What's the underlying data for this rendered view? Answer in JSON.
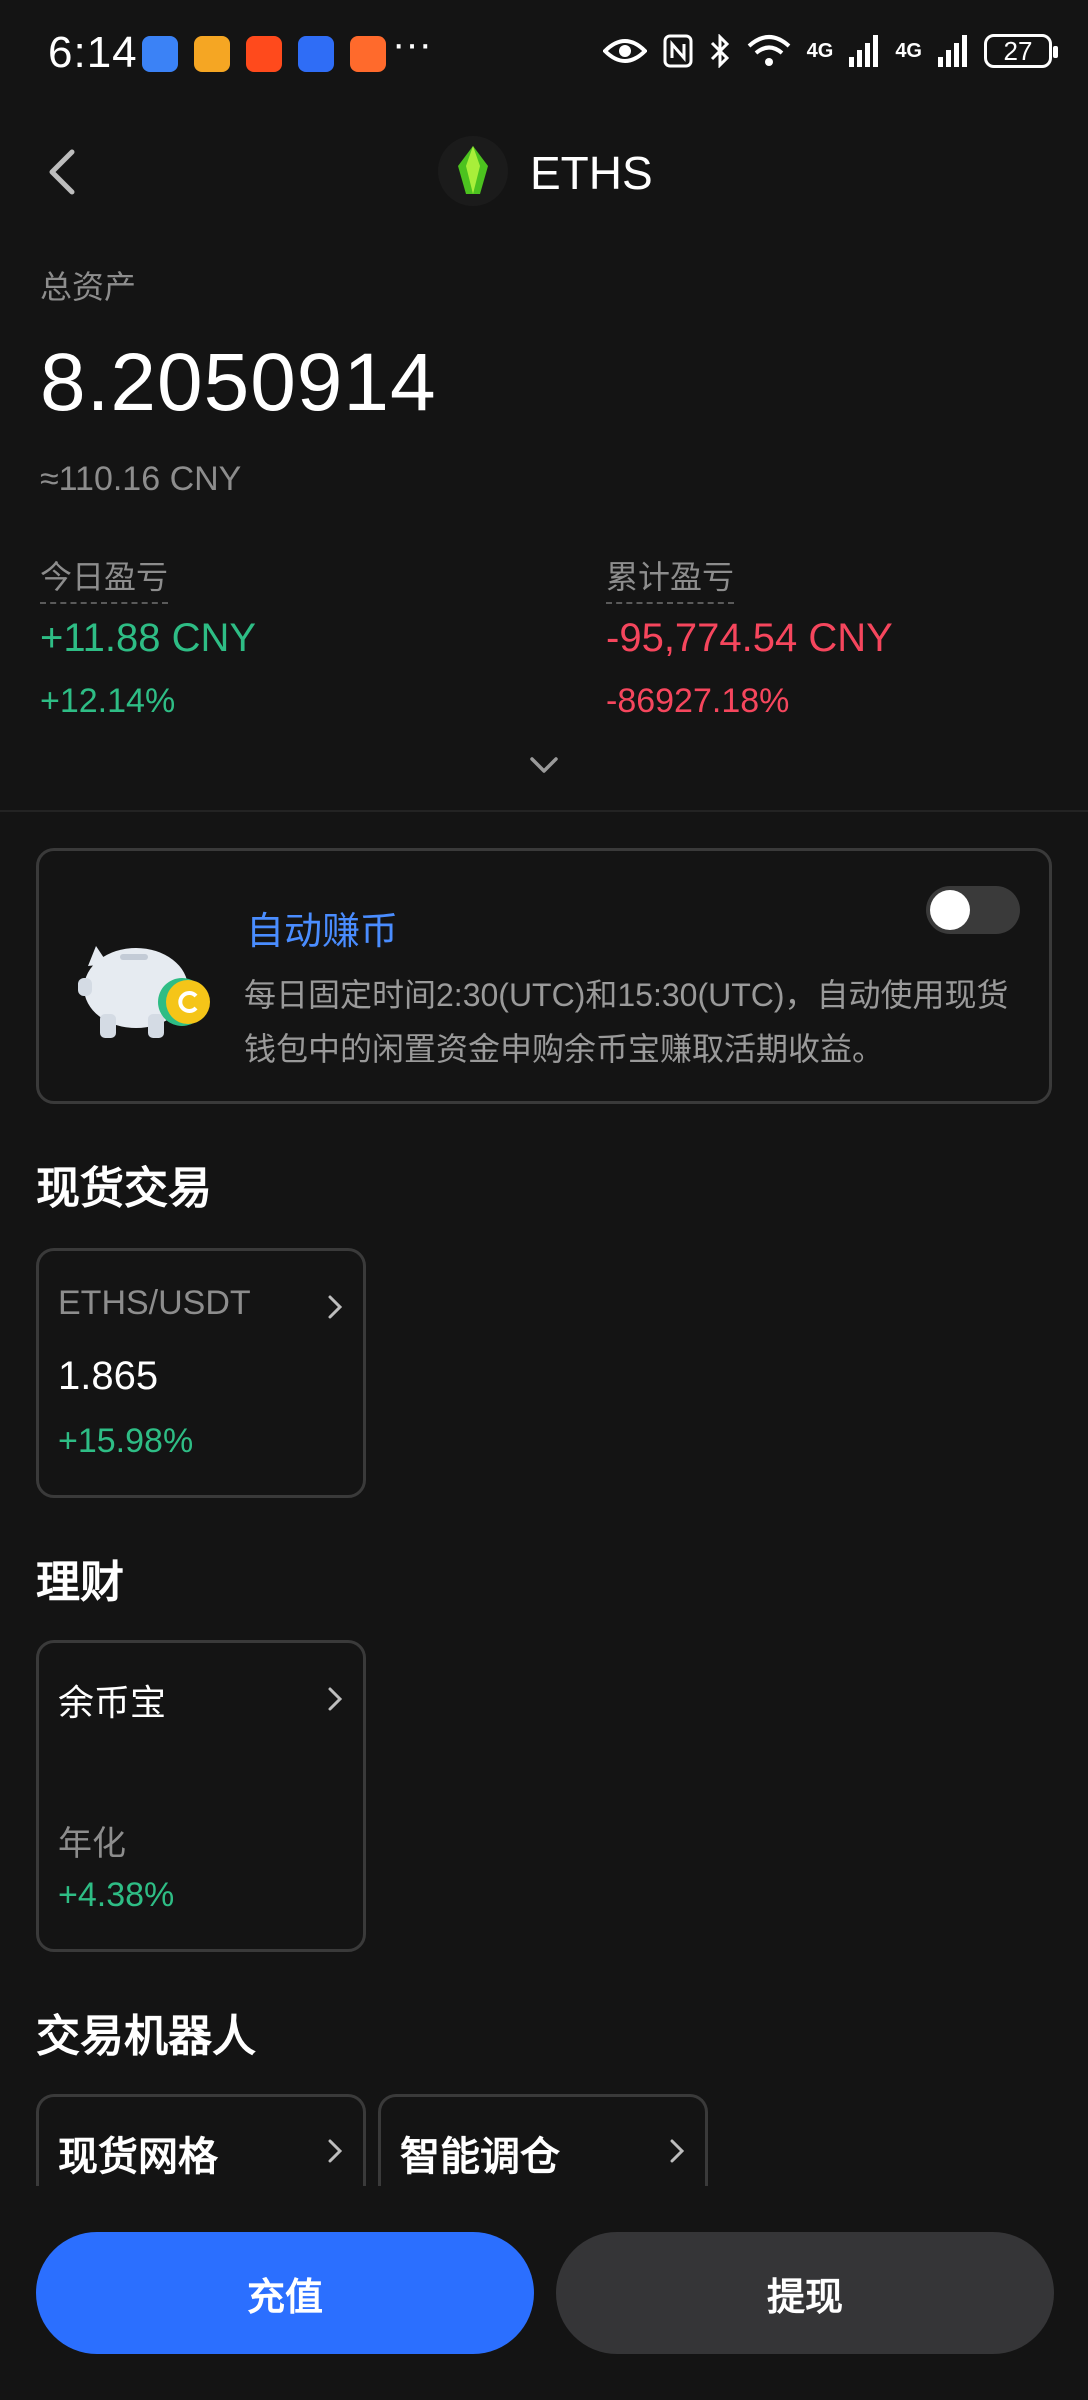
{
  "status_bar": {
    "time": "6:14",
    "more": "···",
    "network1": "4G",
    "network2": "4G",
    "battery": "27"
  },
  "header": {
    "title": "ETHS"
  },
  "summary": {
    "total_label": "总资产",
    "total_value": "8.2050914",
    "total_cny": "≈110.16 CNY",
    "today_label": "今日盈亏",
    "today_value": "+11.88 CNY",
    "today_pct": "+12.14%",
    "cumulative_label": "累计盈亏",
    "cumulative_value": "-95,774.54 CNY",
    "cumulative_pct": "-86927.18%"
  },
  "auto_earn": {
    "title": "自动赚币",
    "description": "每日固定时间2:30(UTC)和15:30(UTC)，自动使用现货钱包中的闲置资金申购余币宝赚取活期收益。",
    "enabled": false
  },
  "spot": {
    "section_title": "现货交易",
    "pair": "ETHS/USDT",
    "price": "1.865",
    "change": "+15.98%"
  },
  "finance": {
    "section_title": "理财",
    "product": "余币宝",
    "annual_label": "年化",
    "annual_rate": "+4.38%"
  },
  "bots": {
    "section_title": "交易机器人",
    "items": [
      {
        "label": "现货网格"
      },
      {
        "label": "智能调仓"
      }
    ]
  },
  "actions": {
    "deposit": "充值",
    "withdraw": "提现"
  },
  "colors": {
    "background": "#141414",
    "positive": "#2ebd85",
    "negative": "#f6465d",
    "accent": "#2b6fff",
    "link": "#4a8dff"
  }
}
